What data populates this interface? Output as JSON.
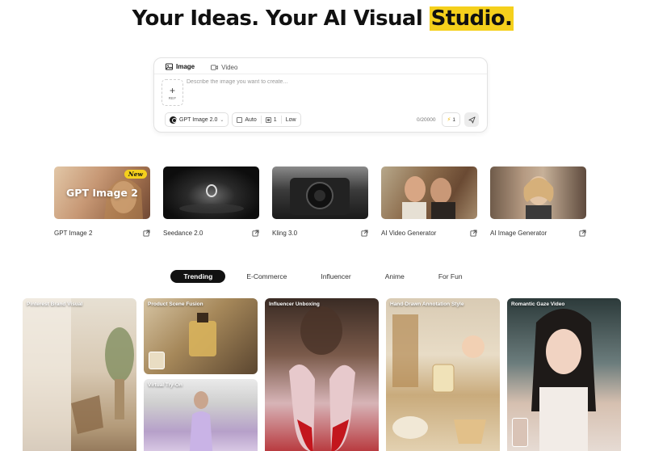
{
  "hero": {
    "title_main": "Your Ideas. Your AI Visual ",
    "title_highlight": "Studio."
  },
  "prompt": {
    "tabs": [
      {
        "label": "Image",
        "active": true
      },
      {
        "label": "Video",
        "active": false
      }
    ],
    "ref_label": "REF",
    "placeholder": "Describe the image you want to create...",
    "model": "GPT Image 2.0",
    "aspect": "Auto",
    "count": "1",
    "quality": "Low",
    "char_counter": "0/20000",
    "credits": "1"
  },
  "features": [
    {
      "name": "GPT Image 2",
      "overlay": "GPT Image 2",
      "badge": "New"
    },
    {
      "name": "Seedance 2.0"
    },
    {
      "name": "Kling 3.0"
    },
    {
      "name": "AI Video Generator"
    },
    {
      "name": "AI Image Generator"
    }
  ],
  "categories": [
    {
      "label": "Trending",
      "active": true
    },
    {
      "label": "E-Commerce",
      "active": false
    },
    {
      "label": "Influencer",
      "active": false
    },
    {
      "label": "Anime",
      "active": false
    },
    {
      "label": "For Fun",
      "active": false
    }
  ],
  "gallery": {
    "pinterest": "Pinterest Brand Visual",
    "product_scene": "Product Scene Fusion",
    "virtual_tryon": "Virtual Try-On",
    "influencer_unboxing": "Influencer Unboxing",
    "hand_drawn": "Hand-Drawn Annotation Style",
    "romantic_gaze": "Romantic Gaze Video"
  },
  "colors": {
    "accent": "#f5d01c",
    "dark": "#111111"
  },
  "icons": {
    "image_tab": "image-icon",
    "video_tab": "video-icon",
    "external": "external-link-icon",
    "send": "send-icon"
  }
}
